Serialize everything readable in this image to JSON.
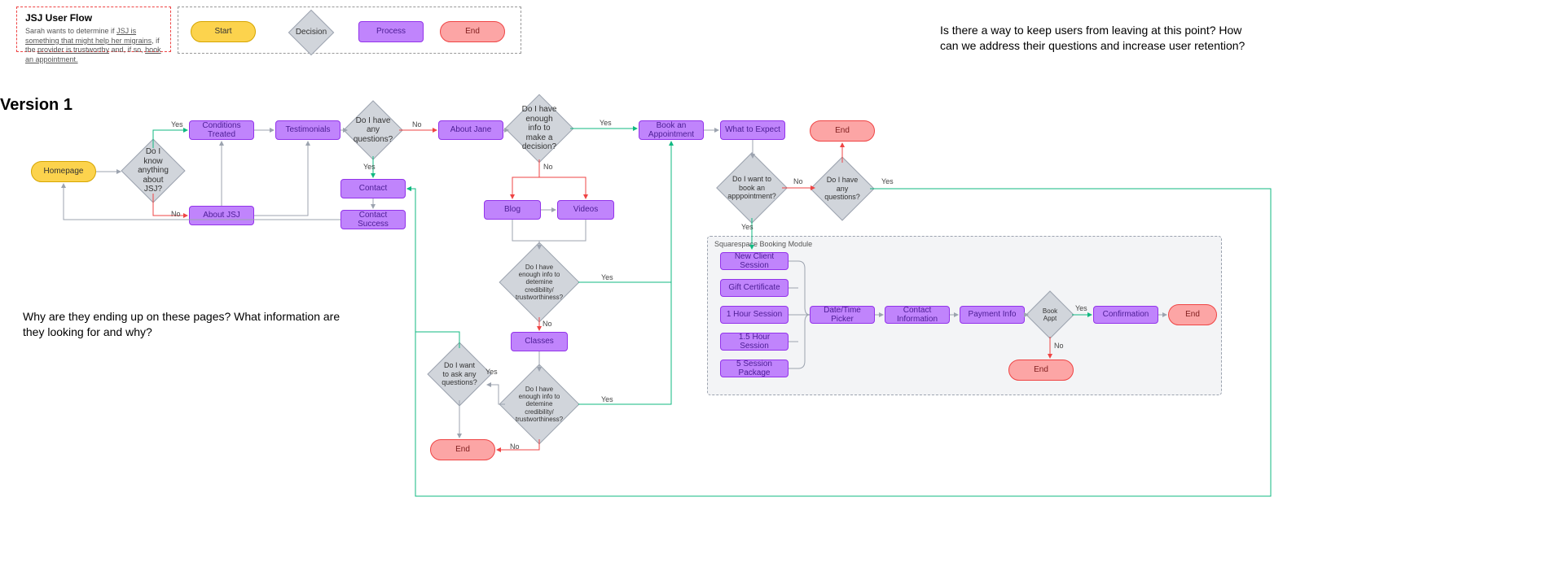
{
  "titleBox": {
    "title": "JSJ User Flow",
    "desc_prefix": "Sarah wants to determine if",
    "u1": "JSJ is something that might help her migrains",
    "desc_mid": ", if the ",
    "u2": "provider is trustworthy",
    "desc_mid2": " and, if so, ",
    "u3": "book an appointment."
  },
  "legend": {
    "start": "Start",
    "decision": "Decision",
    "process": "Process",
    "end": "End"
  },
  "versionHeading": "Version 1",
  "annotationLeft": "Why are they ending up on these pages? What information are they looking for and why?",
  "annotationRight": "Is there a way to keep users from leaving at this point? How can we address their questions and increase user retention?",
  "labels": {
    "yes": "Yes",
    "no": "No"
  },
  "nodes": {
    "homepage": "Homepage",
    "knowJSJ": "Do I know anything about JSJ?",
    "conditions": "Conditions Treated",
    "testimonials": "Testimonials",
    "aboutJSJ": "About JSJ",
    "questions1": "Do I have any questions?",
    "aboutJane": "About Jane",
    "contact": "Contact",
    "contactSuccess": "Contact Success",
    "enoughInfoDecision": "Do I have enough info to make a decision?",
    "blog": "Blog",
    "videos": "Videos",
    "credibility1": "Do I have enough info to detemine credibility/ trustworthiness?",
    "classes": "Classes",
    "credibility2": "Do I have enough info to detemine credibility/ trustworthiness?",
    "askQuestions": "Do I want to ask any questions?",
    "endLeft": "End",
    "bookAppt": "Book an Appointment",
    "whatExpect": "What to Expect",
    "endTop": "End",
    "wantBook": "Do I want to book an apppointment?",
    "questions2": "Do I have any questions?",
    "bookingTitle": "Squarespace Booking Module",
    "newClient": "New Client Session",
    "giftCert": "Gift Certificate",
    "hour1": "1 Hour Session",
    "hour15": "1.5 Hour Session",
    "sess5": "5 Session Package",
    "datetime": "Date/Time Picker",
    "contactInfo": "Contact Information",
    "payment": "Payment Info",
    "bookApptD": "Book Appt",
    "confirmation": "Confirmation",
    "endBookYes": "End",
    "endBookNo": "End"
  }
}
